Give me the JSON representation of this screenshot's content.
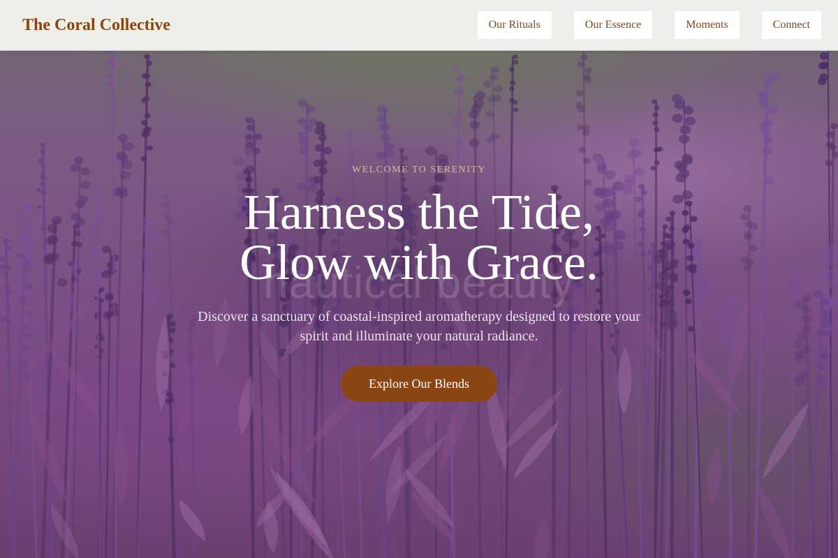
{
  "header": {
    "logo": "The Coral Collective",
    "nav": [
      {
        "label": "Our Rituals"
      },
      {
        "label": "Our Essence"
      },
      {
        "label": "Moments"
      },
      {
        "label": "Connect"
      }
    ]
  },
  "hero": {
    "eyebrow": "WELCOME TO SERENITY",
    "headline_line1": "Harness the Tide,",
    "headline_line2": "Glow with Grace.",
    "ghost_text": "nautical beauty",
    "lead": "Discover a sanctuary of coastal-inspired aromatherapy designed to restore your spirit and illuminate your natural radiance.",
    "cta_label": "Explore Our Blends"
  },
  "colors": {
    "brand": "#8b4513",
    "nav_bg": "#ffffff",
    "header_bg": "#f4f4f0",
    "eyebrow": "#d9b8a8"
  }
}
